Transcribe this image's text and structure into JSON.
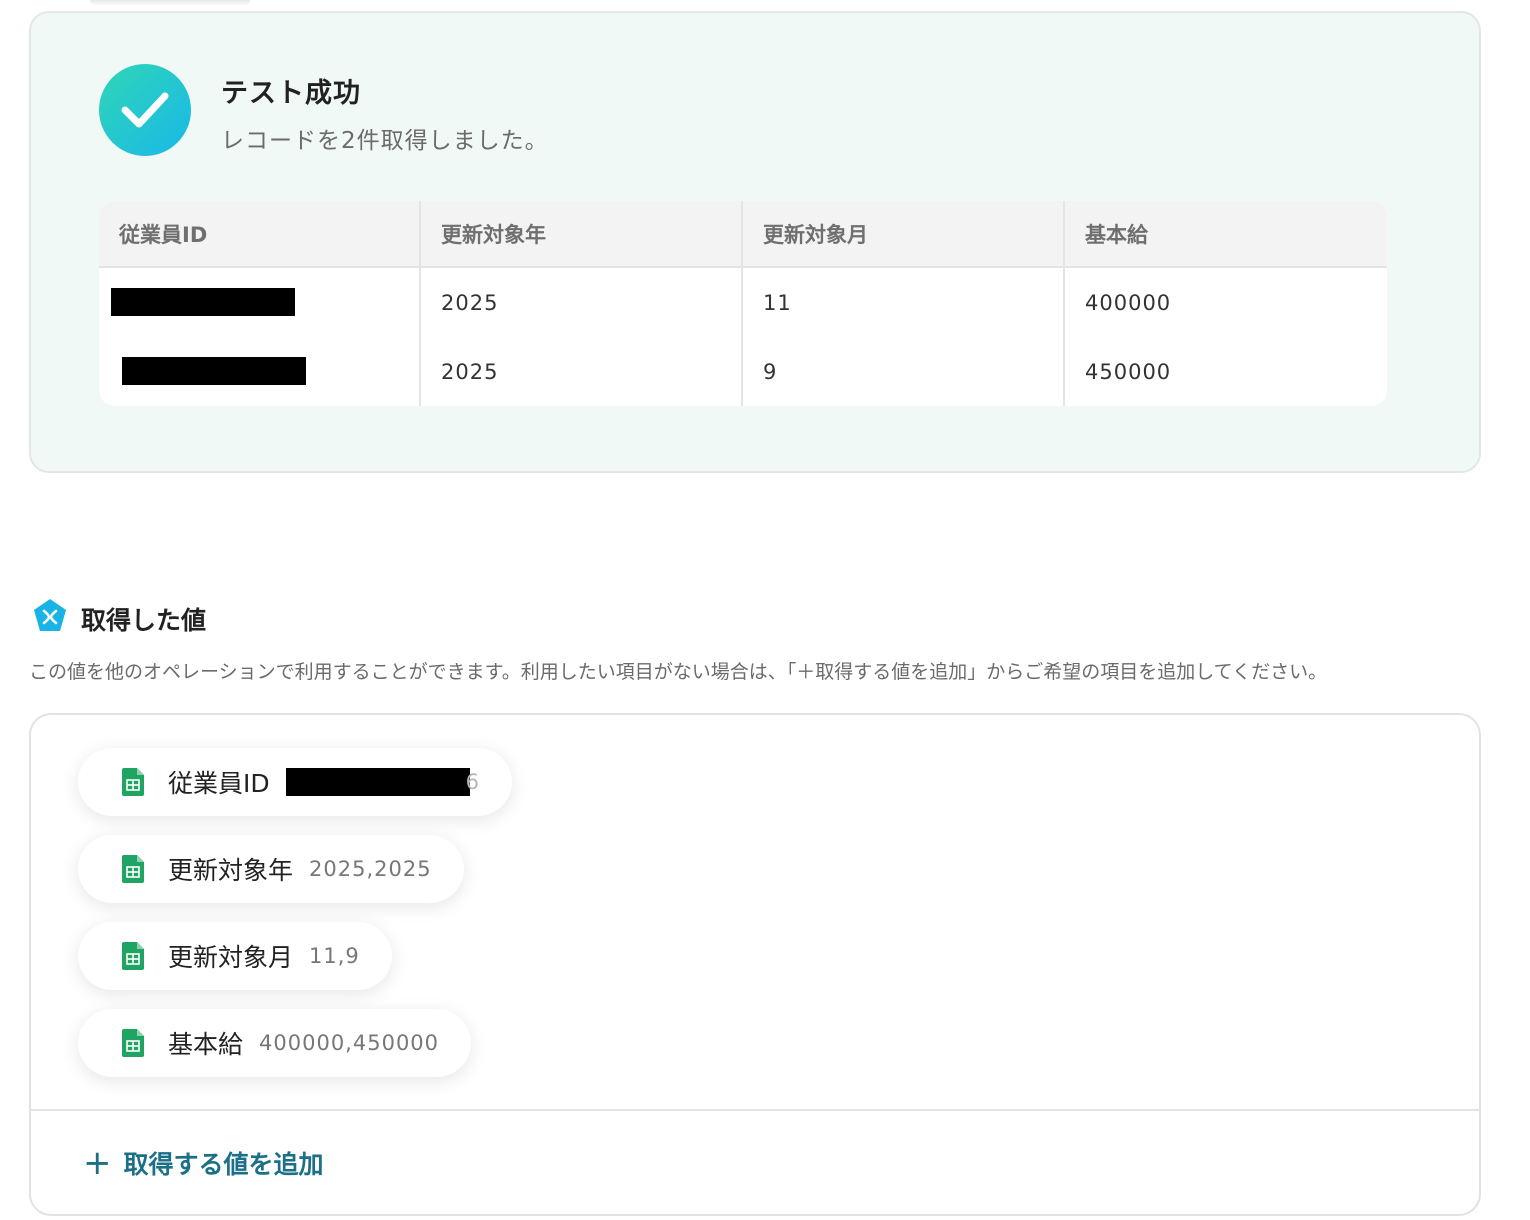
{
  "result": {
    "title": "テスト成功",
    "subtitle": "レコードを2件取得しました。",
    "columns": [
      "従業員ID",
      "更新対象年",
      "更新対象月",
      "基本給"
    ],
    "rows": [
      {
        "year": "2025",
        "month": "11",
        "salary": "400000"
      },
      {
        "year": "2025",
        "month": "9",
        "salary": "450000"
      }
    ]
  },
  "values_section": {
    "title": "取得した値",
    "description": "この値を他のオペレーションで利用することができます。利用したい項目がない場合は、「＋取得する値を追加」からご希望の項目を追加してください。",
    "items": [
      {
        "label": "従業員ID",
        "value": "6"
      },
      {
        "label": "更新対象年",
        "value": "2025,2025"
      },
      {
        "label": "更新対象月",
        "value": "11,9"
      },
      {
        "label": "基本給",
        "value": "400000,450000"
      }
    ],
    "add_button_label": "取得する値を追加",
    "add_button_icon": "plus-icon"
  },
  "colors": {
    "accent": "#1b6f86",
    "success_gradient_start": "#2fd6b6",
    "success_gradient_end": "#19b8e8",
    "sheets_green": "#1fa463"
  }
}
